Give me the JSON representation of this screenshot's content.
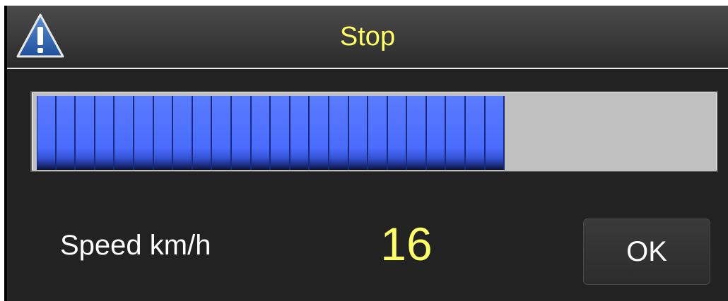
{
  "dialog": {
    "title": "Stop",
    "icon": "warning-icon",
    "title_color": "#ffff66"
  },
  "progress": {
    "value_fraction": 0.69,
    "filled_segments": 24,
    "fill_color": "#4a6cff",
    "track_color": "#c0c0c0"
  },
  "speed": {
    "label": "Speed km/h",
    "value": "16"
  },
  "buttons": {
    "ok_label": "OK"
  }
}
